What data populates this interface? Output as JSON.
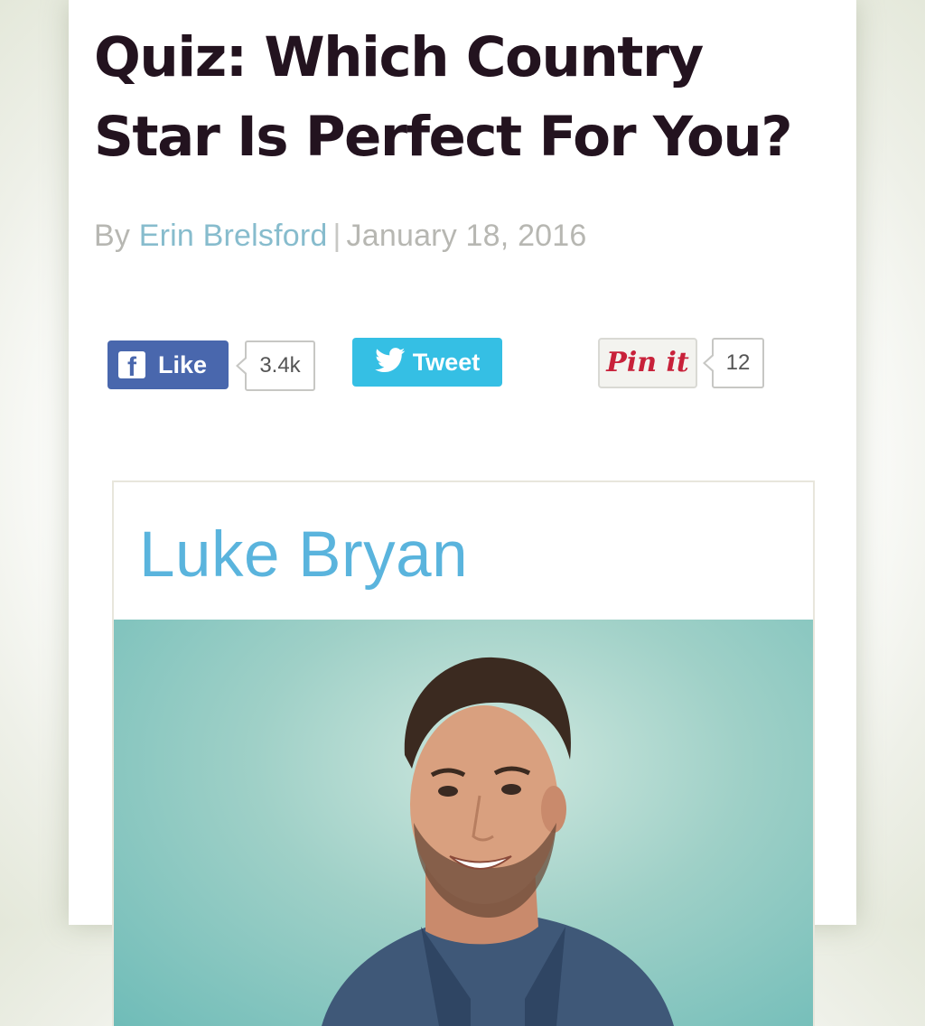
{
  "article": {
    "title": "Quiz: Which Country Star Is Perfect For You?",
    "byline_prefix": "By",
    "author": "Erin Brelsford",
    "separator": "|",
    "date": "January 18, 2016"
  },
  "share": {
    "facebook": {
      "label": "Like",
      "count": "3.4k",
      "icon": "facebook-icon"
    },
    "twitter": {
      "label": "Tweet",
      "icon": "twitter-bird-icon"
    },
    "pinterest": {
      "label": "Pin it",
      "count": "12"
    }
  },
  "quiz_result": {
    "name": "Luke Bryan",
    "image": "luke-bryan-portrait"
  },
  "colors": {
    "title": "#23131f",
    "author_link": "#87bccd",
    "facebook": "#4967ad",
    "twitter": "#35bfe4",
    "pinterest": "#c8213a",
    "result_name": "#5ab4dd"
  }
}
